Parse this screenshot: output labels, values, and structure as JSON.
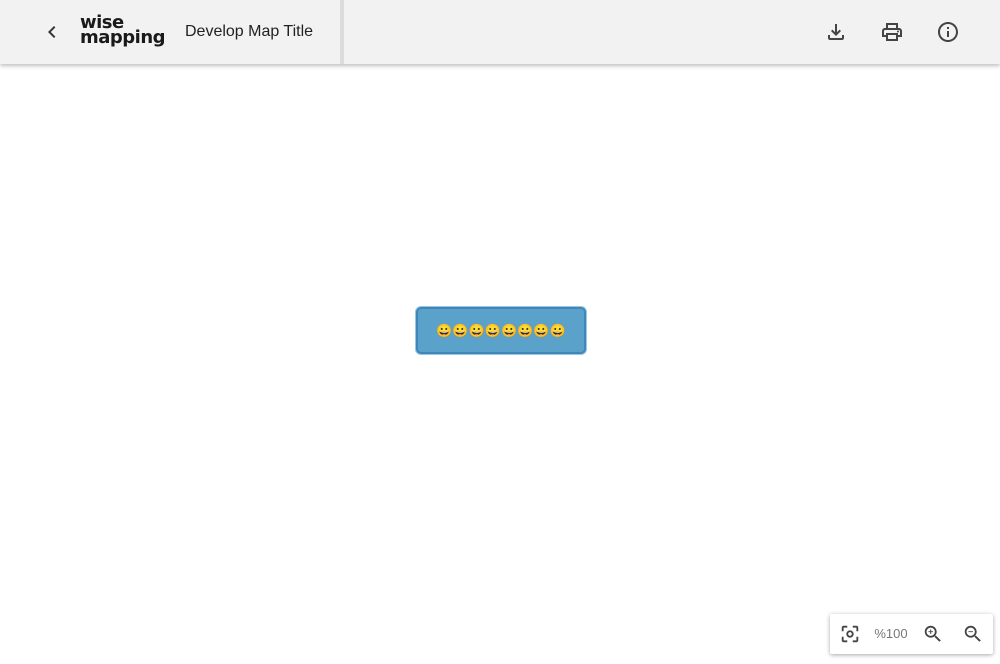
{
  "app": {
    "logo_line1": "wise",
    "logo_line2": "mapping",
    "map_title": "Develop Map Title"
  },
  "toolbar": {
    "back_icon": "chevron-left-icon",
    "download_icon": "download-icon",
    "print_icon": "print-icon",
    "info_icon": "info-icon"
  },
  "canvas": {
    "central_topic": "😀😀😀😀😀😀😀😀",
    "topic_color": "#5aa2c9",
    "topic_border": "#3f86ba"
  },
  "zoom": {
    "level": "%100",
    "fit_icon": "center-focus-icon",
    "zoom_in_icon": "zoom-in-icon",
    "zoom_out_icon": "zoom-out-icon"
  }
}
